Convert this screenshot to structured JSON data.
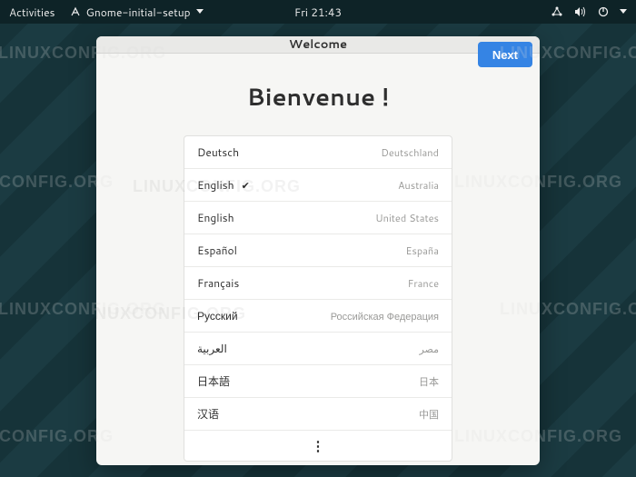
{
  "topbar": {
    "activities": "Activities",
    "app_name": "Gnome-initial-setup",
    "clock": "Fri 21:43"
  },
  "window": {
    "title": "Welcome",
    "next_label": "Next",
    "headline": "Bienvenue !"
  },
  "languages": [
    {
      "name": "Deutsch",
      "region": "Deutschland",
      "selected": false
    },
    {
      "name": "English",
      "region": "Australia",
      "selected": true
    },
    {
      "name": "English",
      "region": "United States",
      "selected": false
    },
    {
      "name": "Español",
      "region": "España",
      "selected": false
    },
    {
      "name": "Français",
      "region": "France",
      "selected": false
    },
    {
      "name": "Русский",
      "region": "Российская Федерация",
      "selected": false
    },
    {
      "name": "العربية",
      "region": "مصر",
      "selected": false
    },
    {
      "name": "日本語",
      "region": "日本",
      "selected": false
    },
    {
      "name": "汉语",
      "region": "中国",
      "selected": false
    }
  ],
  "watermark": "LINUXCONFIG.ORG"
}
